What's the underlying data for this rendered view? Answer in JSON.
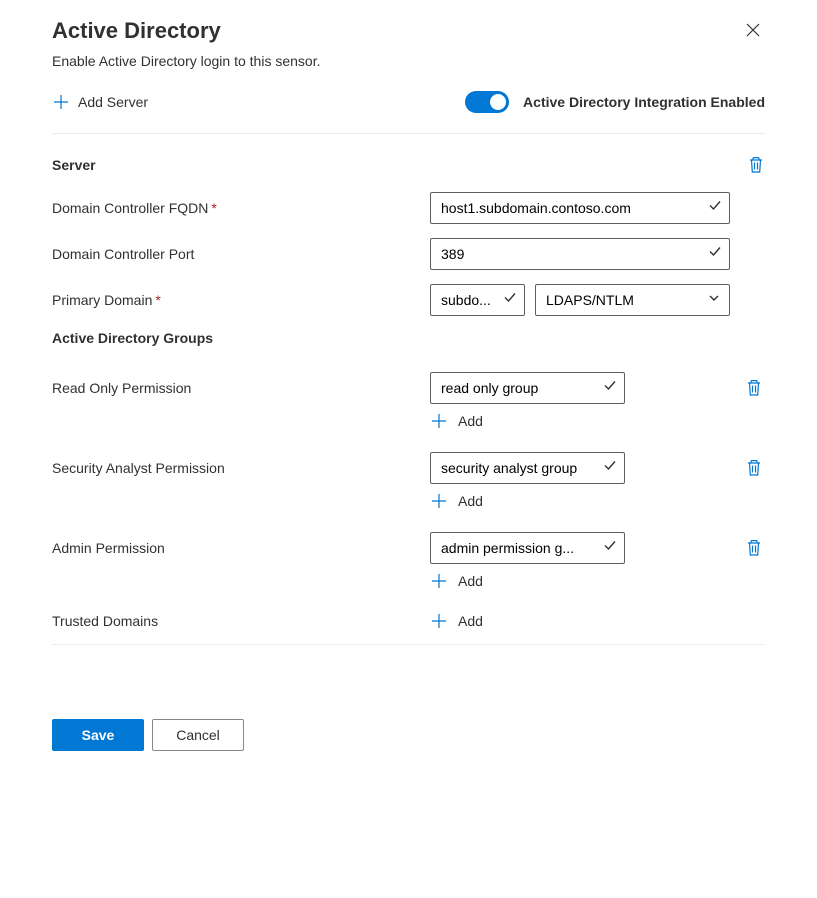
{
  "title": "Active Directory",
  "subtitle": "Enable Active Directory login to this sensor.",
  "toolbar": {
    "add_server_label": "Add Server",
    "toggle_label": "Active Directory Integration Enabled",
    "toggle_on": true
  },
  "server": {
    "section_label": "Server",
    "fqdn_label": "Domain Controller FQDN",
    "fqdn_value": "host1.subdomain.contoso.com",
    "port_label": "Domain Controller Port",
    "port_value": "389",
    "primary_domain_label": "Primary Domain",
    "primary_domain_value": "subdo...",
    "auth_value": "LDAPS/NTLM"
  },
  "groups": {
    "section_label": "Active Directory Groups",
    "read_only_label": "Read Only Permission",
    "read_only_value": "read only group",
    "analyst_label": "Security Analyst Permission",
    "analyst_value": "security analyst group",
    "admin_label": "Admin Permission",
    "admin_value": "admin permission g...",
    "trusted_label": "Trusted Domains",
    "add_label": "Add"
  },
  "footer": {
    "save_label": "Save",
    "cancel_label": "Cancel"
  }
}
